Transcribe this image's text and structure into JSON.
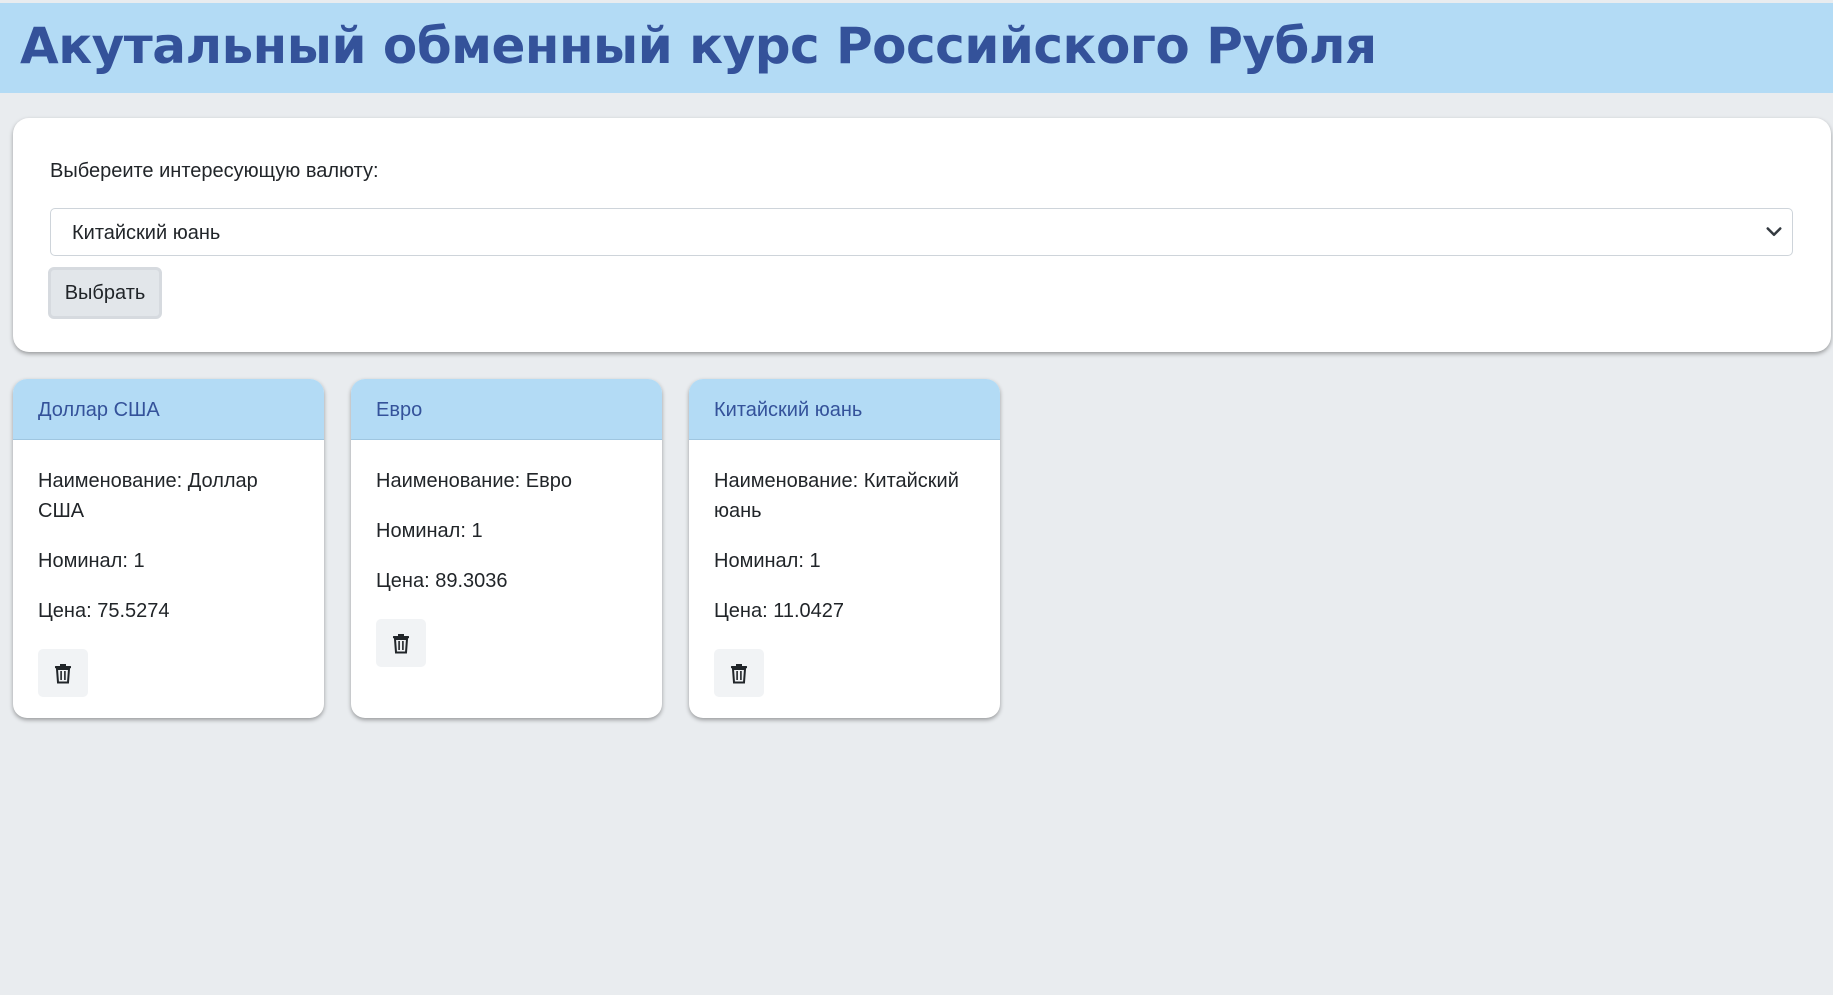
{
  "header": {
    "title": "Акутальный обменный курс Российского Рубля"
  },
  "selector": {
    "label": "Выбереите интересующую валюту:",
    "selected_value": "Китайский юань",
    "button_label": "Выбрать"
  },
  "cards": [
    {
      "title": "Доллар США",
      "name_line": "Наименование: Доллар США",
      "nominal_line": "Номинал: 1",
      "price_line": "Цена: 75.5274",
      "delete_icon": "trash-icon"
    },
    {
      "title": "Евро",
      "name_line": "Наименование: Евро",
      "nominal_line": "Номинал: 1",
      "price_line": "Цена: 89.3036",
      "delete_icon": "trash-icon"
    },
    {
      "title": "Китайский юань",
      "name_line": "Наименование: Китайский юань",
      "nominal_line": "Номинал: 1",
      "price_line": "Цена: 11.0427",
      "delete_icon": "trash-icon"
    }
  ],
  "colors": {
    "header_bg": "#b3dbf5",
    "title_color": "#34529a",
    "page_bg": "#e9ecef"
  }
}
